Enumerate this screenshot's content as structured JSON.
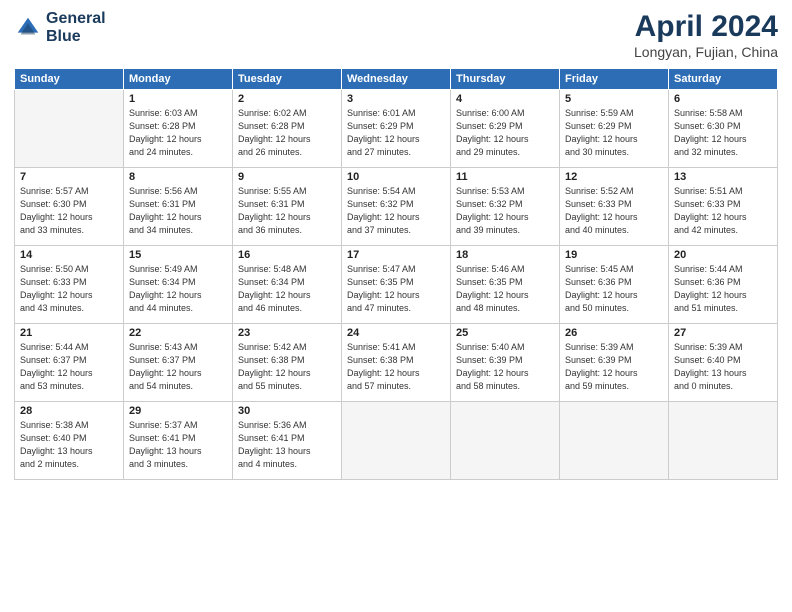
{
  "header": {
    "logo_line1": "General",
    "logo_line2": "Blue",
    "title": "April 2024",
    "location": "Longyan, Fujian, China"
  },
  "weekdays": [
    "Sunday",
    "Monday",
    "Tuesday",
    "Wednesday",
    "Thursday",
    "Friday",
    "Saturday"
  ],
  "weeks": [
    [
      {
        "day": "",
        "info": ""
      },
      {
        "day": "1",
        "info": "Sunrise: 6:03 AM\nSunset: 6:28 PM\nDaylight: 12 hours\nand 24 minutes."
      },
      {
        "day": "2",
        "info": "Sunrise: 6:02 AM\nSunset: 6:28 PM\nDaylight: 12 hours\nand 26 minutes."
      },
      {
        "day": "3",
        "info": "Sunrise: 6:01 AM\nSunset: 6:29 PM\nDaylight: 12 hours\nand 27 minutes."
      },
      {
        "day": "4",
        "info": "Sunrise: 6:00 AM\nSunset: 6:29 PM\nDaylight: 12 hours\nand 29 minutes."
      },
      {
        "day": "5",
        "info": "Sunrise: 5:59 AM\nSunset: 6:29 PM\nDaylight: 12 hours\nand 30 minutes."
      },
      {
        "day": "6",
        "info": "Sunrise: 5:58 AM\nSunset: 6:30 PM\nDaylight: 12 hours\nand 32 minutes."
      }
    ],
    [
      {
        "day": "7",
        "info": "Sunrise: 5:57 AM\nSunset: 6:30 PM\nDaylight: 12 hours\nand 33 minutes."
      },
      {
        "day": "8",
        "info": "Sunrise: 5:56 AM\nSunset: 6:31 PM\nDaylight: 12 hours\nand 34 minutes."
      },
      {
        "day": "9",
        "info": "Sunrise: 5:55 AM\nSunset: 6:31 PM\nDaylight: 12 hours\nand 36 minutes."
      },
      {
        "day": "10",
        "info": "Sunrise: 5:54 AM\nSunset: 6:32 PM\nDaylight: 12 hours\nand 37 minutes."
      },
      {
        "day": "11",
        "info": "Sunrise: 5:53 AM\nSunset: 6:32 PM\nDaylight: 12 hours\nand 39 minutes."
      },
      {
        "day": "12",
        "info": "Sunrise: 5:52 AM\nSunset: 6:33 PM\nDaylight: 12 hours\nand 40 minutes."
      },
      {
        "day": "13",
        "info": "Sunrise: 5:51 AM\nSunset: 6:33 PM\nDaylight: 12 hours\nand 42 minutes."
      }
    ],
    [
      {
        "day": "14",
        "info": "Sunrise: 5:50 AM\nSunset: 6:33 PM\nDaylight: 12 hours\nand 43 minutes."
      },
      {
        "day": "15",
        "info": "Sunrise: 5:49 AM\nSunset: 6:34 PM\nDaylight: 12 hours\nand 44 minutes."
      },
      {
        "day": "16",
        "info": "Sunrise: 5:48 AM\nSunset: 6:34 PM\nDaylight: 12 hours\nand 46 minutes."
      },
      {
        "day": "17",
        "info": "Sunrise: 5:47 AM\nSunset: 6:35 PM\nDaylight: 12 hours\nand 47 minutes."
      },
      {
        "day": "18",
        "info": "Sunrise: 5:46 AM\nSunset: 6:35 PM\nDaylight: 12 hours\nand 48 minutes."
      },
      {
        "day": "19",
        "info": "Sunrise: 5:45 AM\nSunset: 6:36 PM\nDaylight: 12 hours\nand 50 minutes."
      },
      {
        "day": "20",
        "info": "Sunrise: 5:44 AM\nSunset: 6:36 PM\nDaylight: 12 hours\nand 51 minutes."
      }
    ],
    [
      {
        "day": "21",
        "info": "Sunrise: 5:44 AM\nSunset: 6:37 PM\nDaylight: 12 hours\nand 53 minutes."
      },
      {
        "day": "22",
        "info": "Sunrise: 5:43 AM\nSunset: 6:37 PM\nDaylight: 12 hours\nand 54 minutes."
      },
      {
        "day": "23",
        "info": "Sunrise: 5:42 AM\nSunset: 6:38 PM\nDaylight: 12 hours\nand 55 minutes."
      },
      {
        "day": "24",
        "info": "Sunrise: 5:41 AM\nSunset: 6:38 PM\nDaylight: 12 hours\nand 57 minutes."
      },
      {
        "day": "25",
        "info": "Sunrise: 5:40 AM\nSunset: 6:39 PM\nDaylight: 12 hours\nand 58 minutes."
      },
      {
        "day": "26",
        "info": "Sunrise: 5:39 AM\nSunset: 6:39 PM\nDaylight: 12 hours\nand 59 minutes."
      },
      {
        "day": "27",
        "info": "Sunrise: 5:39 AM\nSunset: 6:40 PM\nDaylight: 13 hours\nand 0 minutes."
      }
    ],
    [
      {
        "day": "28",
        "info": "Sunrise: 5:38 AM\nSunset: 6:40 PM\nDaylight: 13 hours\nand 2 minutes."
      },
      {
        "day": "29",
        "info": "Sunrise: 5:37 AM\nSunset: 6:41 PM\nDaylight: 13 hours\nand 3 minutes."
      },
      {
        "day": "30",
        "info": "Sunrise: 5:36 AM\nSunset: 6:41 PM\nDaylight: 13 hours\nand 4 minutes."
      },
      {
        "day": "",
        "info": ""
      },
      {
        "day": "",
        "info": ""
      },
      {
        "day": "",
        "info": ""
      },
      {
        "day": "",
        "info": ""
      }
    ]
  ]
}
